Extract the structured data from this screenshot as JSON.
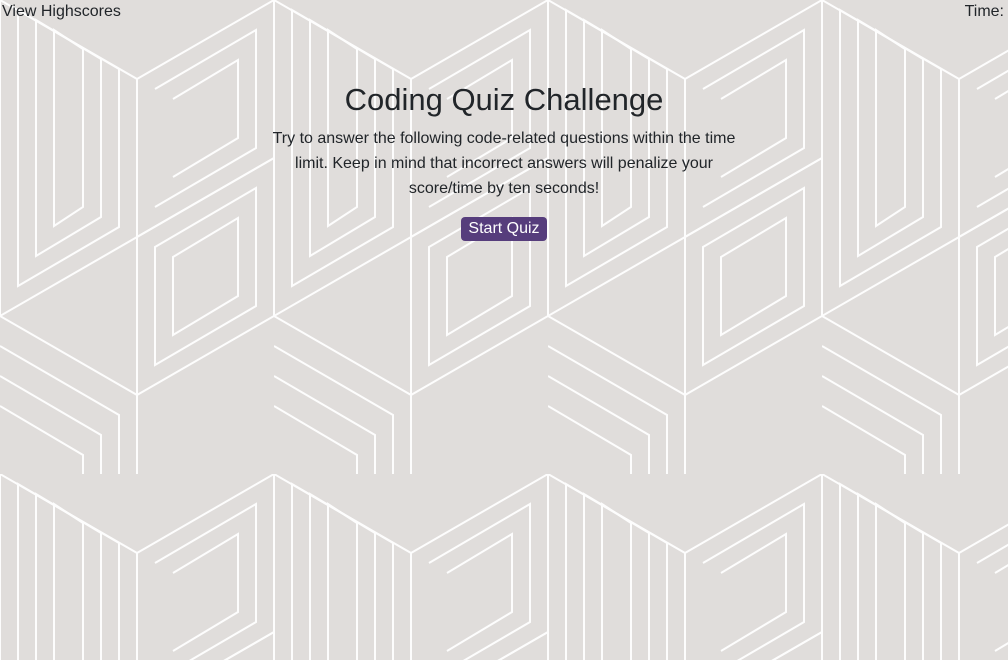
{
  "header": {
    "highscores_link": "View Highscores",
    "timer_label": "Time:",
    "timer_value": ""
  },
  "quiz": {
    "title": "Coding Quiz Challenge",
    "description": "Try to answer the following code-related questions within the time limit. Keep in mind that incorrect answers will penalize your score/time by ten seconds!",
    "start_button": "Start Quiz"
  },
  "colors": {
    "background": "#e0dddb",
    "pattern_lines": "#ffffff",
    "button": "#563d7c",
    "button_text": "#ffffff",
    "text": "#212529"
  }
}
